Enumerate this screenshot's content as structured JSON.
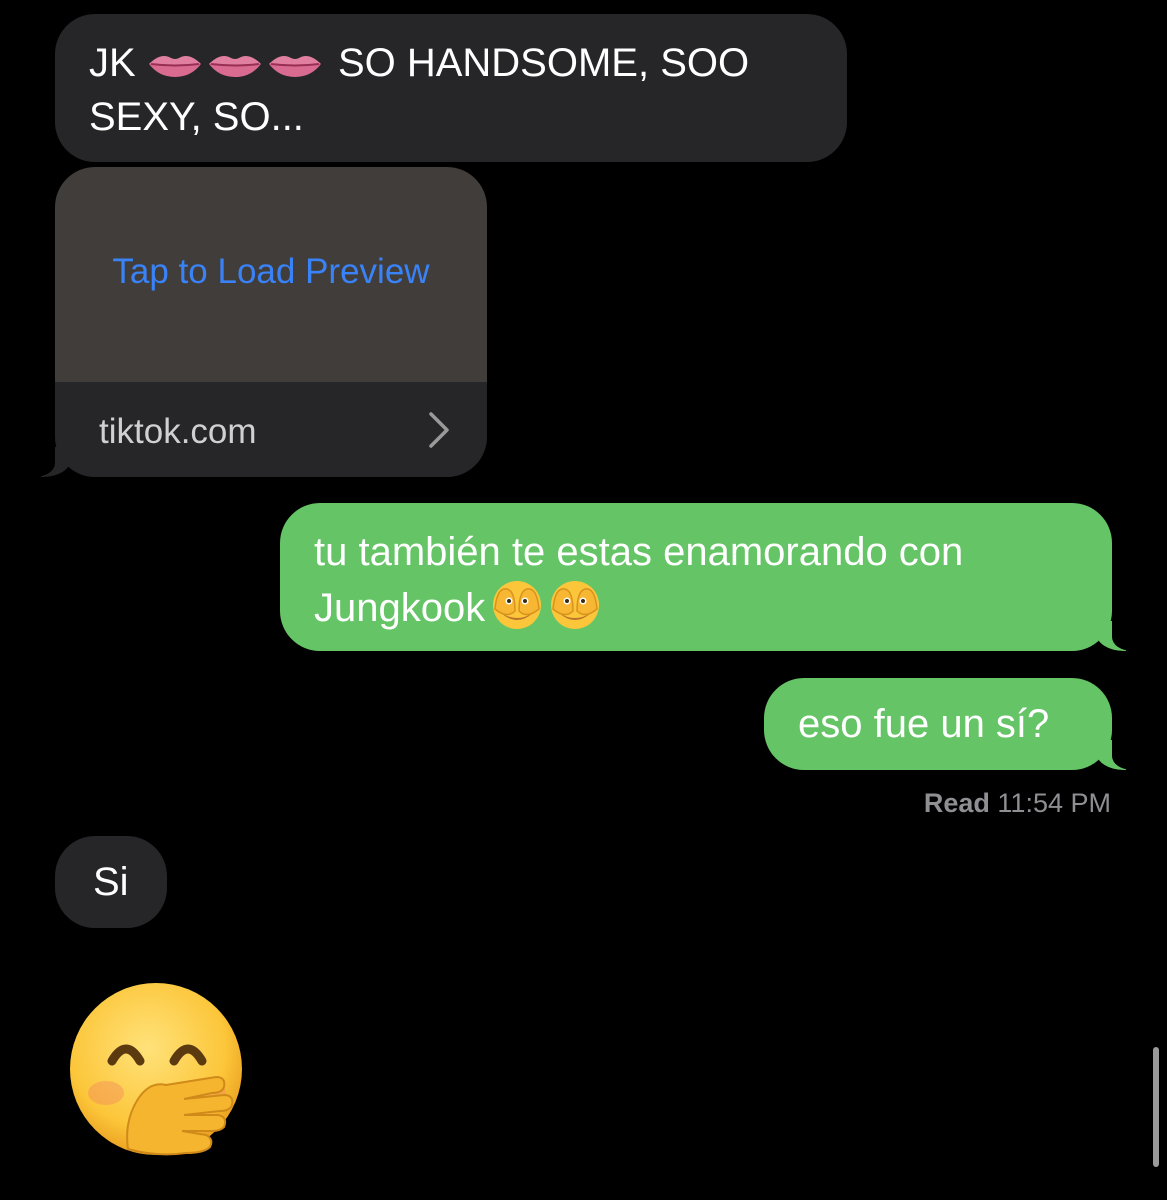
{
  "messages": [
    {
      "direction": "incoming",
      "text_a": "JK",
      "text_b": "SO HANDSOME, SOO",
      "text_c": "SEXY, SO...",
      "emoji_icons": [
        "lips-icon",
        "lips-icon",
        "lips-icon"
      ]
    },
    {
      "direction": "incoming",
      "type": "link",
      "preview_label": "Tap to Load Preview",
      "domain": "tiktok.com"
    },
    {
      "direction": "outgoing",
      "text_a": "tu también te estas enamorando con",
      "text_b": "Jungkook",
      "emoji_icons": [
        "see-no-evil-face-icon",
        "see-no-evil-face-icon"
      ]
    },
    {
      "direction": "outgoing",
      "text": "eso fue un sí?"
    },
    {
      "direction": "incoming",
      "text": "Si"
    },
    {
      "direction": "incoming",
      "type": "emoji",
      "emoji_icon": "face-with-hand-over-mouth-icon"
    }
  ],
  "read_receipt": {
    "label": "Read",
    "time": "11:54 PM"
  },
  "colors": {
    "background": "#000000",
    "incoming_bubble": "#262628",
    "outgoing_bubble": "#65c466",
    "link_preview_bg": "#403d3a",
    "link_text": "#3a82f7",
    "receipt_text": "#8e8e93"
  }
}
